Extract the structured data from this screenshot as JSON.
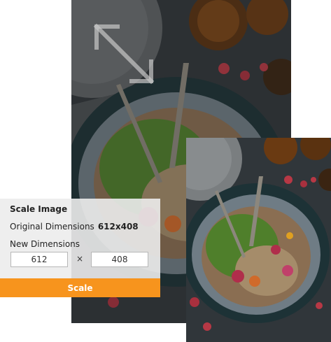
{
  "panel": {
    "title": "Scale Image",
    "original_label": "Original Dimensions",
    "original_value": "612x408",
    "new_label": "New Dimensions",
    "width_value": "612",
    "height_value": "408",
    "times_symbol": "×",
    "scale_button_label": "Scale"
  },
  "icons": {
    "resize": "resize-arrows-icon"
  },
  "colors": {
    "accent": "#f7941d",
    "panel_bg": "#ececec",
    "photo_bg": "#2e3438"
  }
}
